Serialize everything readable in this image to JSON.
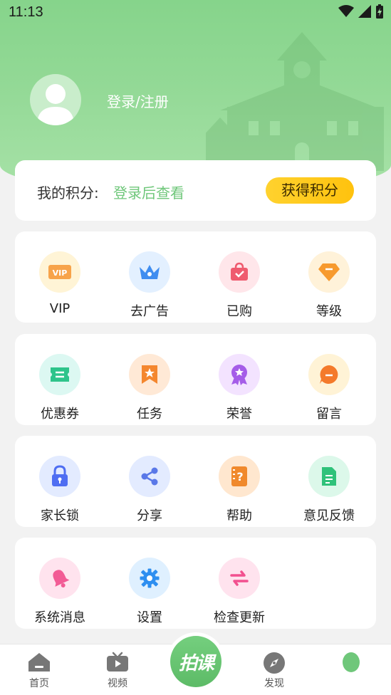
{
  "status": {
    "time": "11:13"
  },
  "profile": {
    "login_text": "登录/注册"
  },
  "points": {
    "label": "我的积分:",
    "value": "登录后查看",
    "button": "获得积分"
  },
  "sections": [
    {
      "items": [
        {
          "label": "VIP",
          "icon": "vip-icon"
        },
        {
          "label": "去广告",
          "icon": "crown-icon"
        },
        {
          "label": "已购",
          "icon": "purchased-bag-icon"
        },
        {
          "label": "等级",
          "icon": "diamond-icon"
        }
      ]
    },
    {
      "items": [
        {
          "label": "优惠券",
          "icon": "coupon-icon"
        },
        {
          "label": "任务",
          "icon": "task-bookmark-icon"
        },
        {
          "label": "荣誉",
          "icon": "medal-icon"
        },
        {
          "label": "留言",
          "icon": "message-bubble-icon"
        }
      ]
    },
    {
      "items": [
        {
          "label": "家长锁",
          "icon": "lock-icon"
        },
        {
          "label": "分享",
          "icon": "share-icon"
        },
        {
          "label": "帮助",
          "icon": "help-book-icon"
        },
        {
          "label": "意见反馈",
          "icon": "feedback-document-icon"
        }
      ]
    },
    {
      "items": [
        {
          "label": "系统消息",
          "icon": "bell-icon"
        },
        {
          "label": "设置",
          "icon": "gear-icon"
        },
        {
          "label": "检查更新",
          "icon": "update-arrows-icon"
        }
      ]
    }
  ],
  "nav": {
    "home": "首页",
    "video": "视频",
    "center_brand": "拍课",
    "discover": "发现"
  },
  "colors": {
    "brand_green": "#6fc77a",
    "button_yellow": "#ffc20e"
  }
}
